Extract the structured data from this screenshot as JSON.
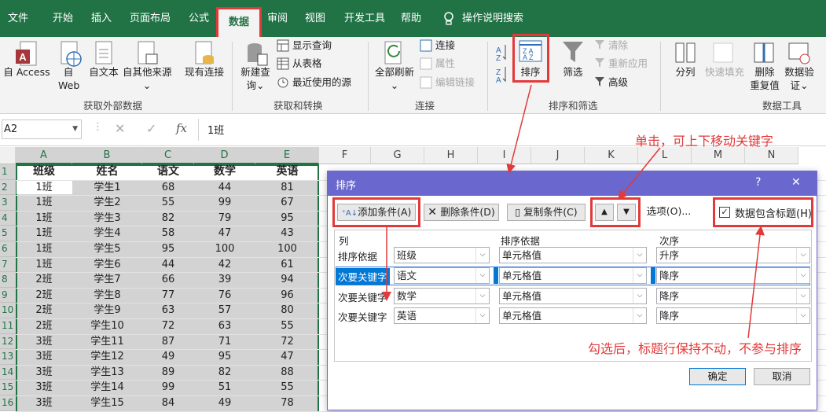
{
  "tabs": [
    "文件",
    "开始",
    "插入",
    "页面布局",
    "公式",
    "数据",
    "审阅",
    "视图",
    "开发工具",
    "帮助",
    "操作说明搜索"
  ],
  "ribbon": {
    "access": "自 Access",
    "web1": "自",
    "web2": "Web",
    "text": "自文本",
    "other": "自其他来源",
    "existing": "现有连接",
    "group_external": "获取外部数据",
    "new_query1": "新建查",
    "new_query2": "询",
    "show_query": "显示查询",
    "from_table": "从表格",
    "recent_sources": "最近使用的源",
    "group_transform": "获取和转换",
    "refresh_all": "全部刷新",
    "connections": "连接",
    "properties": "属性",
    "edit_links": "编辑链接",
    "group_connections": "连接",
    "sort": "排序",
    "filter": "筛选",
    "clear": "清除",
    "reapply": "重新应用",
    "advanced": "高级",
    "group_sort_filter": "排序和筛选",
    "split": "分列",
    "flash_fill": "快速填充",
    "remove_dup1": "删除",
    "remove_dup2": "重复值",
    "validation1": "数据验",
    "validation2": "证",
    "group_data_tools": "数据工具"
  },
  "formula_bar": {
    "name_box": "A2",
    "fx": "fx",
    "value": "1班"
  },
  "columns": [
    "A",
    "B",
    "C",
    "D",
    "E",
    "F",
    "G",
    "H",
    "I",
    "J",
    "K",
    "L",
    "M",
    "N"
  ],
  "rows": [
    "1",
    "2",
    "3",
    "4",
    "5",
    "6",
    "7",
    "8",
    "9",
    "10",
    "11",
    "12",
    "13",
    "14",
    "15",
    "16"
  ],
  "table": {
    "header": [
      "班级",
      "姓名",
      "语文",
      "数学",
      "英语"
    ],
    "data": [
      [
        "1班",
        "学生1",
        "68",
        "44",
        "81"
      ],
      [
        "1班",
        "学生2",
        "55",
        "99",
        "67"
      ],
      [
        "1班",
        "学生3",
        "82",
        "79",
        "95"
      ],
      [
        "1班",
        "学生4",
        "58",
        "47",
        "43"
      ],
      [
        "1班",
        "学生5",
        "95",
        "100",
        "100"
      ],
      [
        "1班",
        "学生6",
        "44",
        "42",
        "61"
      ],
      [
        "2班",
        "学生7",
        "66",
        "39",
        "94"
      ],
      [
        "2班",
        "学生8",
        "77",
        "76",
        "96"
      ],
      [
        "2班",
        "学生9",
        "63",
        "57",
        "80"
      ],
      [
        "2班",
        "学生10",
        "72",
        "63",
        "55"
      ],
      [
        "3班",
        "学生11",
        "87",
        "71",
        "72"
      ],
      [
        "3班",
        "学生12",
        "49",
        "95",
        "47"
      ],
      [
        "3班",
        "学生13",
        "89",
        "82",
        "88"
      ],
      [
        "3班",
        "学生14",
        "99",
        "51",
        "55"
      ],
      [
        "3班",
        "学生15",
        "84",
        "49",
        "78"
      ]
    ]
  },
  "dialog": {
    "title": "排序",
    "help": "?",
    "close": "✕",
    "add_level": "添加条件(A)",
    "delete_level": "删除条件(D)",
    "copy_level": "复制条件(C)",
    "move_up": "▲",
    "move_down": "▼",
    "options": "选项(O)...",
    "has_headers": "数据包含标题(H)",
    "col_header": "列",
    "sorton_header": "排序依据",
    "order_header": "次序",
    "levels": [
      {
        "label": "排序依据",
        "column": "班级",
        "sort_on": "单元格值",
        "order": "升序"
      },
      {
        "label": "次要关键字",
        "column": "语文",
        "sort_on": "单元格值",
        "order": "降序"
      },
      {
        "label": "次要关键字",
        "column": "数学",
        "sort_on": "单元格值",
        "order": "降序"
      },
      {
        "label": "次要关键字",
        "column": "英语",
        "sort_on": "单元格值",
        "order": "降序"
      }
    ],
    "ok": "确定",
    "cancel": "取消"
  },
  "annotations": {
    "move": "单击，可上下移动关键字",
    "headers": "勾选后，标题行保持不动，不参与排序"
  },
  "colors": {
    "excel_green": "#217346",
    "dialog_blue": "#6a67ce",
    "highlight_red": "#e23a3a",
    "selection_grey": "#d3d3d3"
  }
}
